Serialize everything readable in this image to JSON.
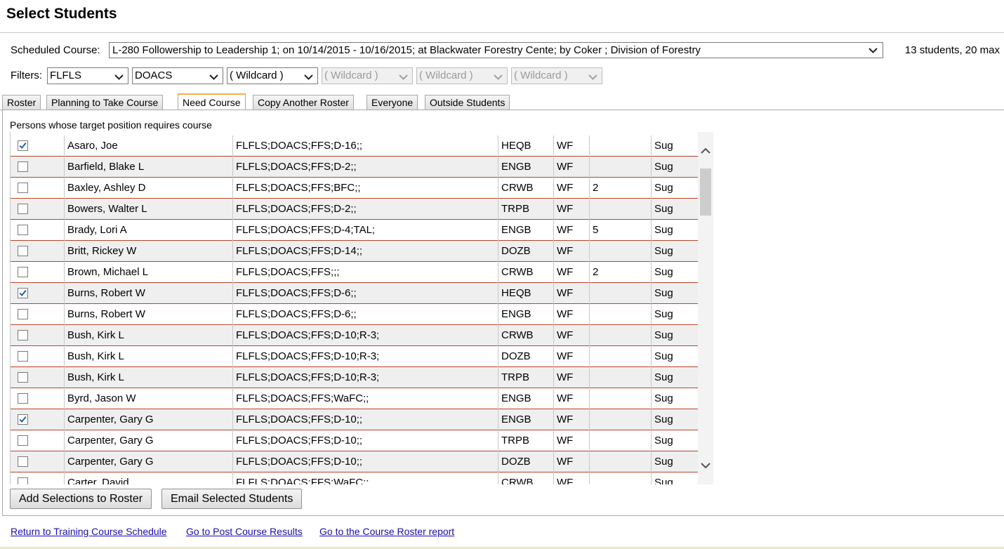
{
  "page": {
    "title": "Select Students"
  },
  "course": {
    "label": "Scheduled Course:",
    "selected": "L-280 Followership to Leadership 1; on 10/14/2015 - 10/16/2015; at Blackwater Forestry Cente; by Coker ; Division of Forestry",
    "count": "13 students, 20 max"
  },
  "filters": {
    "label": "Filters:",
    "items": [
      {
        "value": "FLFLS",
        "disabled": false
      },
      {
        "value": "DOACS",
        "disabled": false
      },
      {
        "value": "( Wildcard )",
        "disabled": false
      },
      {
        "value": "( Wildcard )",
        "disabled": true
      },
      {
        "value": "( Wildcard )",
        "disabled": true
      },
      {
        "value": "( Wildcard )",
        "disabled": true
      }
    ]
  },
  "tabs": [
    {
      "label": "Roster",
      "active": false
    },
    {
      "label": "Planning to Take Course",
      "active": false
    },
    {
      "label": "Need Course",
      "active": true
    },
    {
      "label": "Copy Another Roster",
      "active": false
    },
    {
      "label": "Everyone",
      "active": false
    },
    {
      "label": "Outside Students",
      "active": false
    }
  ],
  "panel": {
    "caption": "Persons whose target position requires course"
  },
  "rows": [
    {
      "checked": true,
      "name": "Asaro, Joe",
      "org": "FLFLS;DOACS;FFS;D-16;;",
      "position": "HEQB",
      "type": "WF",
      "num": "",
      "status": "Sug"
    },
    {
      "checked": false,
      "name": "Barfield, Blake L",
      "org": "FLFLS;DOACS;FFS;D-2;;",
      "position": "ENGB",
      "type": "WF",
      "num": "",
      "status": "Sug"
    },
    {
      "checked": false,
      "name": "Baxley, Ashley D",
      "org": "FLFLS;DOACS;FFS;BFC;;",
      "position": "CRWB",
      "type": "WF",
      "num": "2",
      "status": "Sug"
    },
    {
      "checked": false,
      "name": "Bowers, Walter L",
      "org": "FLFLS;DOACS;FFS;D-2;;",
      "position": "TRPB",
      "type": "WF",
      "num": "",
      "status": "Sug"
    },
    {
      "checked": false,
      "name": "Brady, Lori A",
      "org": "FLFLS;DOACS;FFS;D-4;TAL;",
      "position": "ENGB",
      "type": "WF",
      "num": "5",
      "status": "Sug"
    },
    {
      "checked": false,
      "name": "Britt, Rickey W",
      "org": "FLFLS;DOACS;FFS;D-14;;",
      "position": "DOZB",
      "type": "WF",
      "num": "",
      "status": "Sug"
    },
    {
      "checked": false,
      "name": "Brown, Michael L",
      "org": "FLFLS;DOACS;FFS;;;",
      "position": "CRWB",
      "type": "WF",
      "num": "2",
      "status": "Sug"
    },
    {
      "checked": true,
      "name": "Burns, Robert W",
      "org": "FLFLS;DOACS;FFS;D-6;;",
      "position": "HEQB",
      "type": "WF",
      "num": "",
      "status": "Sug"
    },
    {
      "checked": false,
      "name": "Burns, Robert W",
      "org": "FLFLS;DOACS;FFS;D-6;;",
      "position": "ENGB",
      "type": "WF",
      "num": "",
      "status": "Sug"
    },
    {
      "checked": false,
      "name": "Bush, Kirk L",
      "org": "FLFLS;DOACS;FFS;D-10;R-3;",
      "position": "CRWB",
      "type": "WF",
      "num": "",
      "status": "Sug"
    },
    {
      "checked": false,
      "name": "Bush, Kirk L",
      "org": "FLFLS;DOACS;FFS;D-10;R-3;",
      "position": "DOZB",
      "type": "WF",
      "num": "",
      "status": "Sug"
    },
    {
      "checked": false,
      "name": "Bush, Kirk L",
      "org": "FLFLS;DOACS;FFS;D-10;R-3;",
      "position": "TRPB",
      "type": "WF",
      "num": "",
      "status": "Sug"
    },
    {
      "checked": false,
      "name": "Byrd, Jason W",
      "org": "FLFLS;DOACS;FFS;WaFC;;",
      "position": "ENGB",
      "type": "WF",
      "num": "",
      "status": "Sug"
    },
    {
      "checked": true,
      "name": "Carpenter, Gary G",
      "org": "FLFLS;DOACS;FFS;D-10;;",
      "position": "ENGB",
      "type": "WF",
      "num": "",
      "status": "Sug"
    },
    {
      "checked": false,
      "name": "Carpenter, Gary G",
      "org": "FLFLS;DOACS;FFS;D-10;;",
      "position": "TRPB",
      "type": "WF",
      "num": "",
      "status": "Sug"
    },
    {
      "checked": false,
      "name": "Carpenter, Gary G",
      "org": "FLFLS;DOACS;FFS;D-10;;",
      "position": "DOZB",
      "type": "WF",
      "num": "",
      "status": "Sug"
    },
    {
      "checked": false,
      "name": "Carter, David",
      "org": "FLFLS;DOACS;FFS;WaFC;;",
      "position": "CRWB",
      "type": "WF",
      "num": "",
      "status": "Sug"
    }
  ],
  "actions": {
    "add_label": "Add Selections to Roster",
    "email_label": "Email Selected Students"
  },
  "links": [
    "Return to Training Course Schedule",
    "Go to Post Course Results",
    "Go to the Course Roster report"
  ],
  "colors": {
    "row_separator": "#b5462a",
    "active_tab_accent": "#f0b14a",
    "link": "#1a0dab",
    "checkmark": "#1d5ea8"
  }
}
